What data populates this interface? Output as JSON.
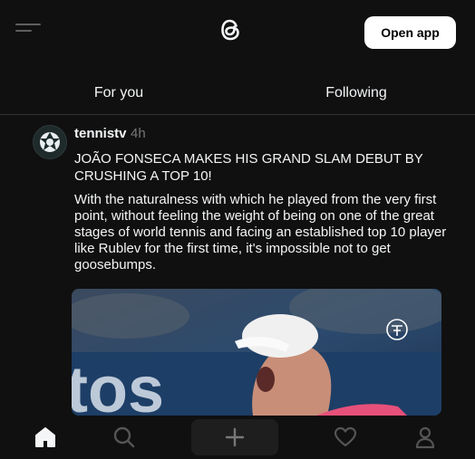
{
  "header": {
    "menu_icon": "menu-icon",
    "logo_icon": "threads-logo-icon",
    "open_app_label": "Open app"
  },
  "tabs": [
    {
      "label": "For you"
    },
    {
      "label": "Following"
    }
  ],
  "post": {
    "username": "tennistv",
    "time": "4h",
    "avatar_icon": "tennistv-avatar-icon",
    "headline": "JOÃO FONSECA MAKES HIS GRAND SLAM DEBUT BY CRUSHING A TOP 10!",
    "body": "With the naturalness with which he played from the very first point, without feeling the weight of being on one of the great stages of world tennis and facing an established top 10 player like Rublev for the first time, it's impossible not to get goosebumps.",
    "media_icon": "player-photo",
    "media_text": "tos"
  },
  "bottom_nav": [
    {
      "icon": "home-icon"
    },
    {
      "icon": "search-icon"
    },
    {
      "icon": "plus-icon"
    },
    {
      "icon": "heart-icon"
    },
    {
      "icon": "profile-icon"
    }
  ],
  "colors": {
    "background": "#101010",
    "text": "#f3f5f7",
    "muted": "#777777",
    "button_bg": "#ffffff"
  }
}
